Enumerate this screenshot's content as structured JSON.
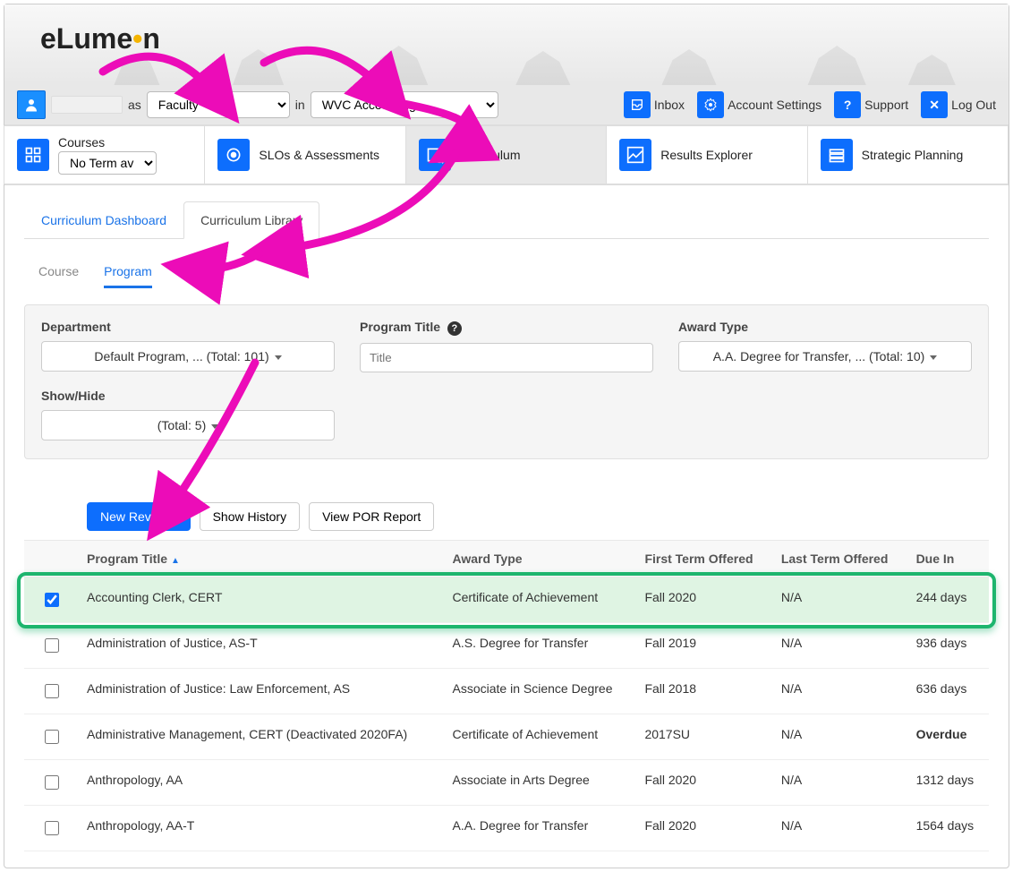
{
  "brand": {
    "name_part1": "eLume",
    "name_part2": "n"
  },
  "topbar": {
    "as_label": "as",
    "role": "Faculty",
    "in_label": "in",
    "department": "WVC Accounting",
    "links": {
      "inbox": "Inbox",
      "account": "Account Settings",
      "support": "Support",
      "logout": "Log Out"
    }
  },
  "nav": {
    "courses": {
      "label": "Courses",
      "term": "No Term avai..."
    },
    "slos": "SLOs & Assessments",
    "curriculum": "Curriculum",
    "results": "Results Explorer",
    "strategic": "Strategic Planning"
  },
  "subtabs": {
    "dashboard": "Curriculum Dashboard",
    "library": "Curriculum Library"
  },
  "modetabs": {
    "course": "Course",
    "program": "Program"
  },
  "filters": {
    "department_label": "Department",
    "department_value": "Default Program, ... (Total: 101)",
    "title_label": "Program Title",
    "title_placeholder": "Title",
    "award_label": "Award Type",
    "award_value": "A.A. Degree for Transfer, ... (Total: 10)",
    "showhide_label": "Show/Hide",
    "showhide_value": "(Total: 5)"
  },
  "actions": {
    "new_revision": "New Revision",
    "show_history": "Show History",
    "view_por": "View POR Report"
  },
  "columns": {
    "program_title": "Program Title",
    "award_type": "Award Type",
    "first_term": "First Term Offered",
    "last_term": "Last Term Offered",
    "due_in": "Due In"
  },
  "rows": [
    {
      "checked": true,
      "title": "Accounting Clerk, CERT",
      "award": "Certificate of Achievement",
      "first": "Fall 2020",
      "last": "N/A",
      "due": "244 days",
      "overdue": false
    },
    {
      "checked": false,
      "title": "Administration of Justice, AS-T",
      "award": "A.S. Degree for Transfer",
      "first": "Fall 2019",
      "last": "N/A",
      "due": "936 days",
      "overdue": false
    },
    {
      "checked": false,
      "title": "Administration of Justice: Law Enforcement, AS",
      "award": "Associate in Science Degree",
      "first": "Fall 2018",
      "last": "N/A",
      "due": "636 days",
      "overdue": false
    },
    {
      "checked": false,
      "title": "Administrative Management, CERT (Deactivated 2020FA)",
      "award": "Certificate of Achievement",
      "first": "2017SU",
      "last": "N/A",
      "due": "Overdue",
      "overdue": true
    },
    {
      "checked": false,
      "title": "Anthropology, AA",
      "award": "Associate in Arts Degree",
      "first": "Fall 2020",
      "last": "N/A",
      "due": "1312 days",
      "overdue": false
    },
    {
      "checked": false,
      "title": "Anthropology, AA-T",
      "award": "A.A. Degree for Transfer",
      "first": "Fall 2020",
      "last": "N/A",
      "due": "1564 days",
      "overdue": false
    }
  ]
}
